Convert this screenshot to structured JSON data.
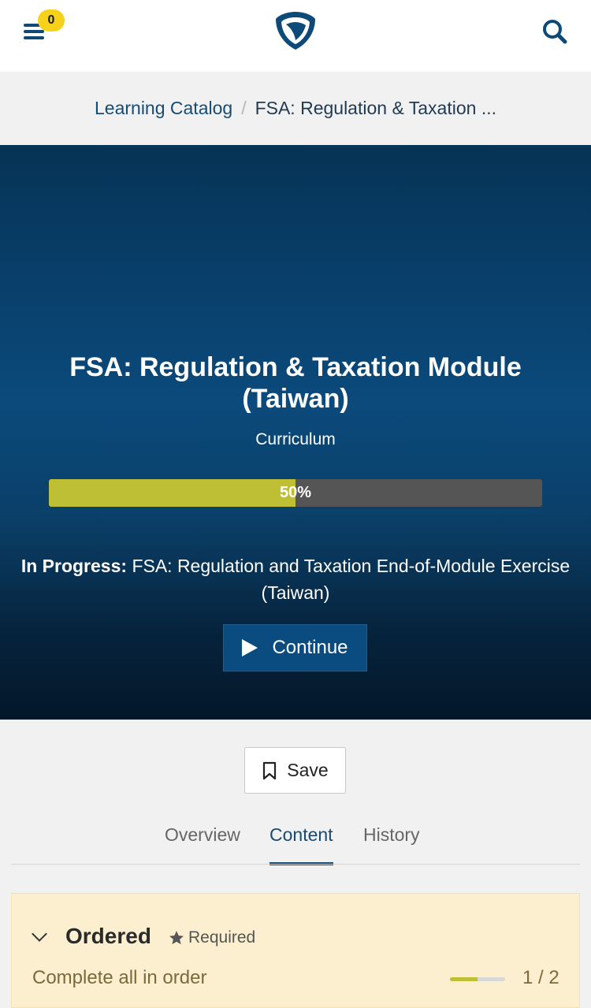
{
  "header": {
    "notification_count": "0",
    "icons": {
      "menu": "hamburger-menu-icon",
      "logo": "shield-logo-icon",
      "search": "search-icon"
    }
  },
  "breadcrumb": {
    "root": "Learning Catalog",
    "current": "FSA: Regulation & Taxation ..."
  },
  "hero": {
    "title": "FSA: Regulation & Taxation Module (Taiwan)",
    "type": "Curriculum",
    "progress_percent": 50,
    "progress_label": "50%",
    "in_progress_label": "In Progress:",
    "in_progress_item": "FSA: Regulation and Taxation End-of-Module Exercise (Taiwan)",
    "continue_label": "Continue"
  },
  "actions": {
    "save_label": "Save"
  },
  "tabs": [
    {
      "label": "Overview",
      "active": false
    },
    {
      "label": "Content",
      "active": true
    },
    {
      "label": "History",
      "active": false
    }
  ],
  "section": {
    "title": "Ordered",
    "required_label": "Required",
    "subtitle": "Complete all in order",
    "progress_fraction": 0.5,
    "count": "1 / 2"
  },
  "colors": {
    "brand_blue": "#174b73",
    "progress_fill": "#bfbf35",
    "badge_yellow": "#f7d21b",
    "section_background": "#fbefcf"
  }
}
